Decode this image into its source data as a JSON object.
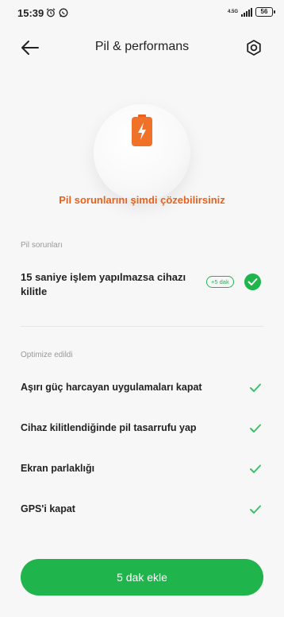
{
  "status_bar": {
    "time": "15:39",
    "network_top": "4.5G",
    "network_bottom": "",
    "battery": "56"
  },
  "header": {
    "title": "Pil & performans"
  },
  "hero": {
    "message": "Pil sorunlarını şimdi çözebilirsiniz"
  },
  "issues_section": {
    "label": "Pil sorunları",
    "items": [
      {
        "text": "15 saniye işlem yapılmazsa cihazı kilitle",
        "badge": "+5 dak",
        "checked": true
      }
    ]
  },
  "optimized_section": {
    "label": "Optimize edildi",
    "items": [
      {
        "text": "Aşırı güç harcayan uygulamaları kapat"
      },
      {
        "text": "Cihaz kilitlendiğinde pil tasarrufu yap"
      },
      {
        "text": "Ekran parlaklığı"
      },
      {
        "text": "GPS'i kapat"
      }
    ]
  },
  "action_button": {
    "label": "5 dak  ekle"
  },
  "colors": {
    "accent_green": "#1fb44c",
    "warning_orange": "#e8621c"
  }
}
